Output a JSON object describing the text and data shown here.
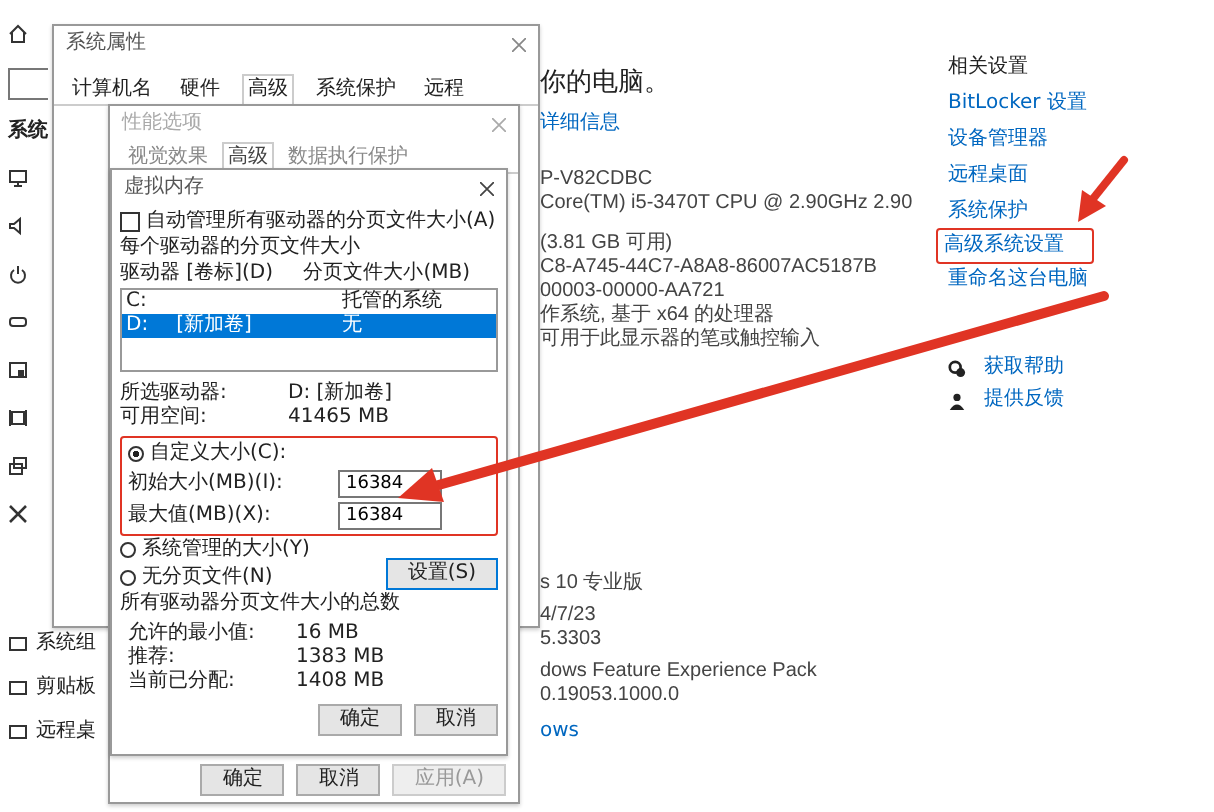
{
  "settings": {
    "sidebar": {
      "heading": "系统",
      "items": [
        {
          "label": "系统组"
        },
        {
          "label": "剪贴板"
        },
        {
          "label": "远程桌"
        }
      ]
    },
    "about": {
      "heading": "你的电脑。",
      "link": "详细信息",
      "specs": [
        "P-V82CDBC",
        "Core(TM) i5-3470T CPU @ 2.90GHz   2.90",
        "(3.81 GB 可用)",
        "C8-A745-44C7-A8A8-86007AC5187B",
        "00003-00000-AA721",
        "作系统, 基于 x64 的处理器",
        "可用于此显示器的笔或触控输入"
      ],
      "windows_specs": [
        "s 10 专业版",
        "4/7/23",
        "5.3303",
        "dows Feature Experience Pack",
        "0.19053.1000.0"
      ],
      "bottom_link": "ows"
    },
    "related": {
      "heading": "相关设置",
      "links": [
        {
          "label": "BitLocker 设置",
          "highlighted": false
        },
        {
          "label": "设备管理器",
          "highlighted": false
        },
        {
          "label": "远程桌面",
          "highlighted": false
        },
        {
          "label": "系统保护",
          "highlighted": false
        },
        {
          "label": "高级系统设置",
          "highlighted": true
        },
        {
          "label": "重命名这台电脑",
          "highlighted": false
        }
      ],
      "help": [
        {
          "kind": "help",
          "label": "获取帮助"
        },
        {
          "kind": "feedback",
          "label": "提供反馈"
        }
      ]
    }
  },
  "system_properties": {
    "title": "系统属性",
    "tabs": [
      {
        "label": "计算机名",
        "selected": false
      },
      {
        "label": "硬件",
        "selected": false
      },
      {
        "label": "高级",
        "selected": true
      },
      {
        "label": "系统保护",
        "selected": false
      },
      {
        "label": "远程",
        "selected": false
      }
    ]
  },
  "performance_options": {
    "title": "性能选项",
    "tabs": [
      {
        "label": "视觉效果",
        "selected": false
      },
      {
        "label": "高级",
        "selected": true
      },
      {
        "label": "数据执行保护",
        "selected": false
      }
    ],
    "buttons": [
      {
        "label": "确定",
        "disabled": false
      },
      {
        "label": "取消",
        "disabled": false
      },
      {
        "label": "应用(A)",
        "disabled": true
      }
    ]
  },
  "virtual_memory": {
    "title": "虚拟内存",
    "auto_manage": {
      "label": "自动管理所有驱动器的分页文件大小(A)",
      "checked": false
    },
    "section_label": "每个驱动器的分页文件大小",
    "columns": [
      "驱动器 [卷标](D)",
      "分页文件大小(MB)"
    ],
    "drives": [
      {
        "drive": "C:",
        "size": "托管的系统",
        "selected": false
      },
      {
        "drive": "D:",
        "label": "[新加卷]",
        "size": "无",
        "selected": true
      }
    ],
    "selected_drive": {
      "label": "所选驱动器:",
      "value": "D:  [新加卷]"
    },
    "free_space": {
      "label": "可用空间:",
      "value": "41465 MB"
    },
    "custom_size": {
      "label": "自定义大小(C):",
      "selected": true,
      "highlighted": true,
      "initial": {
        "label": "初始大小(MB)(I):",
        "value": "16384"
      },
      "maximum": {
        "label": "最大值(MB)(X):",
        "value": "16384"
      }
    },
    "other_options": [
      {
        "label": "系统管理的大小(Y)",
        "selected": false
      },
      {
        "label": "无分页文件(N)",
        "selected": false
      }
    ],
    "set_button": "设置(S)",
    "totals_label": "所有驱动器分页文件大小的总数",
    "totals": [
      {
        "label": "允许的最小值:",
        "value": "16 MB"
      },
      {
        "label": "推荐:",
        "value": "1383 MB"
      },
      {
        "label": "当前已分配:",
        "value": "1408 MB"
      }
    ],
    "buttons": [
      "确定",
      "取消"
    ]
  }
}
